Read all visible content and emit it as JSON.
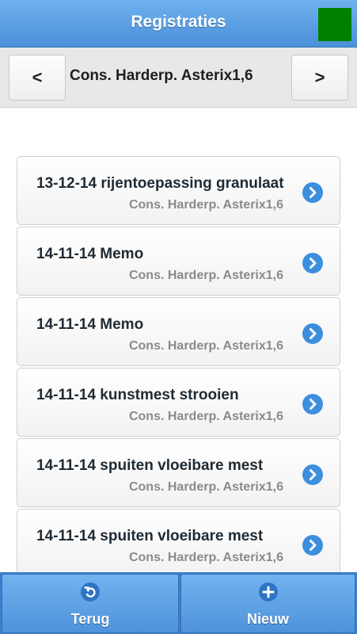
{
  "header": {
    "title": "Registraties",
    "status_color": "#008000"
  },
  "nav": {
    "prev_label": "<",
    "next_label": ">",
    "current_label": "Cons. Harderp. Asterix1,6"
  },
  "list": {
    "items": [
      {
        "title": "13-12-14 rijentoepassing granulaat",
        "subtitle": "Cons. Harderp. Asterix1,6",
        "icon": "chevron-right-icon"
      },
      {
        "title": "14-11-14 Memo",
        "subtitle": "Cons. Harderp. Asterix1,6",
        "icon": "chevron-right-icon"
      },
      {
        "title": "14-11-14 Memo",
        "subtitle": "Cons. Harderp. Asterix1,6",
        "icon": "chevron-right-icon"
      },
      {
        "title": "14-11-14 kunstmest strooien",
        "subtitle": "Cons. Harderp. Asterix1,6",
        "icon": "chevron-right-icon"
      },
      {
        "title": "14-11-14 spuiten vloeibare mest",
        "subtitle": "Cons. Harderp. Asterix1,6",
        "icon": "chevron-right-icon"
      },
      {
        "title": "14-11-14 spuiten vloeibare mest",
        "subtitle": "Cons. Harderp. Asterix1,6",
        "icon": "chevron-right-icon"
      }
    ]
  },
  "footer": {
    "back_label": "Terug",
    "back_icon": "undo-icon",
    "new_label": "Nieuw",
    "new_icon": "plus-icon"
  },
  "colors": {
    "accent": "#4a90d9",
    "chevron": "#3d8fde"
  }
}
